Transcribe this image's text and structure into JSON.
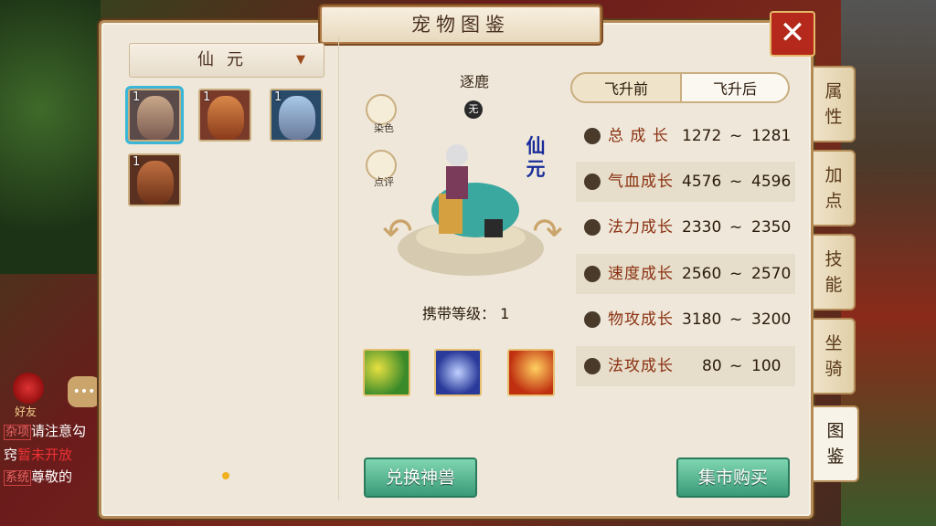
{
  "window": {
    "title": "宠物图鉴",
    "close_label": "✕"
  },
  "category_dropdown": {
    "selected": "仙元",
    "arrow": "▼"
  },
  "pet_list": [
    {
      "level": "1",
      "selected": true
    },
    {
      "level": "1",
      "selected": false
    },
    {
      "level": "1",
      "selected": false
    },
    {
      "level": "1",
      "selected": false
    }
  ],
  "pet": {
    "name": "逐鹿",
    "badge": "无",
    "vertical_title": [
      "仙",
      "元"
    ],
    "dye_label": "染色",
    "review_label": "点评",
    "carry_level_label": "携带等级：",
    "carry_level_value": "1"
  },
  "tabs": {
    "before": "飞升前",
    "after": "飞升后",
    "active": "before"
  },
  "stats": [
    {
      "label": "总 成 长",
      "min": "1272",
      "max": "1281",
      "icon": "growth-icon"
    },
    {
      "label": "气血成长",
      "min": "4576",
      "max": "4596",
      "icon": "heart-icon"
    },
    {
      "label": "法力成长",
      "min": "2330",
      "max": "2350",
      "icon": "drop-icon"
    },
    {
      "label": "速度成长",
      "min": "2560",
      "max": "2570",
      "icon": "speed-icon"
    },
    {
      "label": "物攻成长",
      "min": "3180",
      "max": "3200",
      "icon": "sword-icon"
    },
    {
      "label": "法攻成长",
      "min": "80",
      "max": "100",
      "icon": "flame-icon"
    }
  ],
  "tilde": "~",
  "buttons": {
    "exchange": "兑换神兽",
    "market": "集市购买"
  },
  "side_tabs": [
    {
      "label": [
        "属",
        "性"
      ]
    },
    {
      "label": [
        "加",
        "点"
      ]
    },
    {
      "label": [
        "技",
        "能"
      ]
    },
    {
      "label": [
        "坐",
        "骑"
      ]
    },
    {
      "label": [
        "图",
        "鉴"
      ],
      "active": true
    }
  ],
  "chat": {
    "friend_label": "好友",
    "line1_tag": "杂项",
    "line1_text": "请注意勾",
    "line2_prefix": "窍",
    "line2_red": "暂未开放",
    "line3_tag": "系统",
    "line3_text": "尊敬的"
  }
}
